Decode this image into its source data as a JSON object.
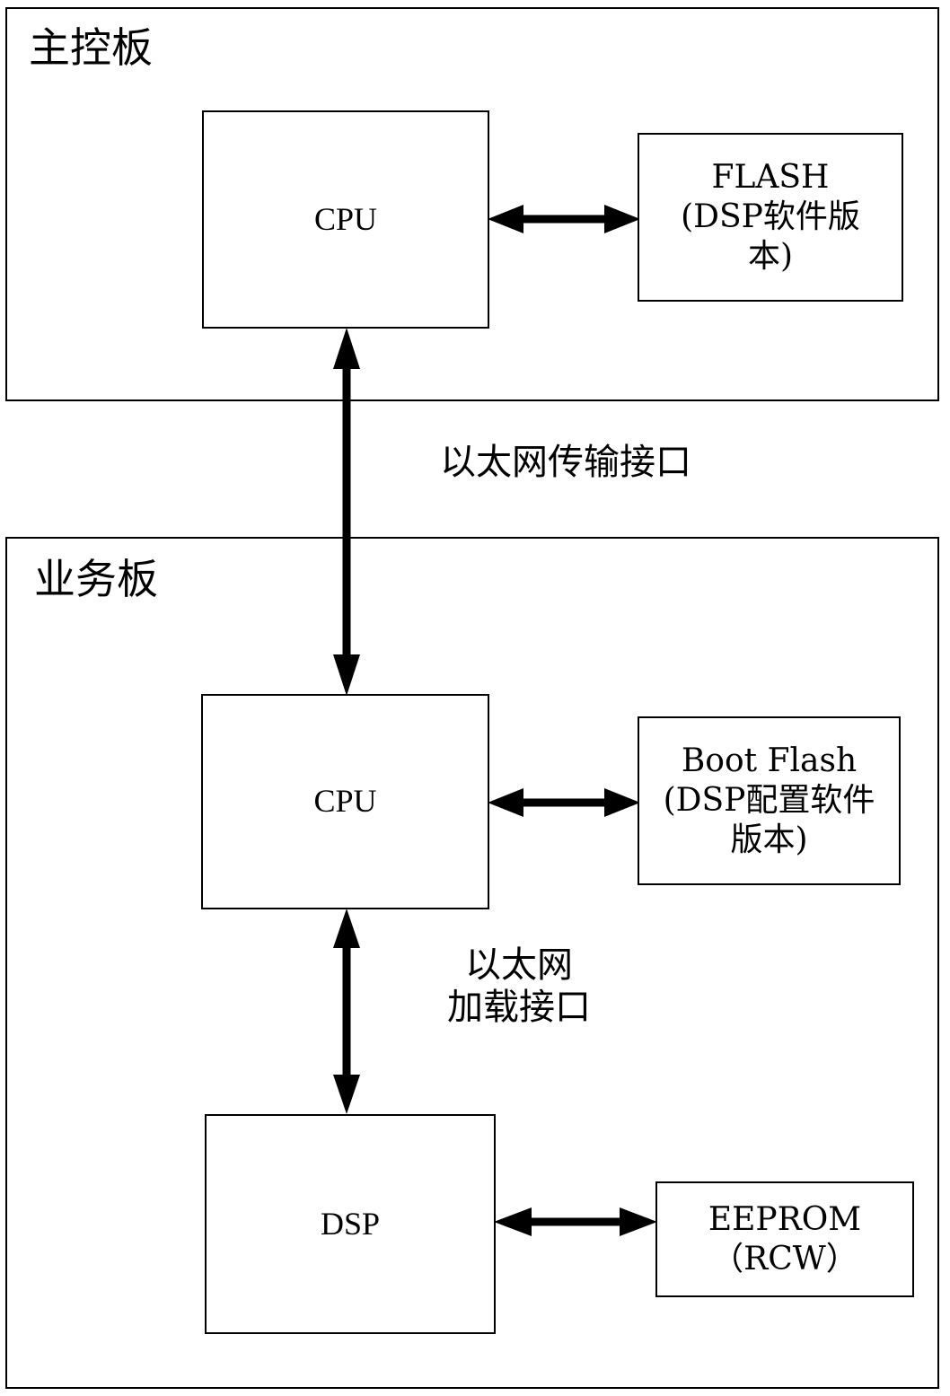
{
  "diagram": {
    "title": "",
    "panels": [
      {
        "id": "main-control-board",
        "label": "主控板"
      },
      {
        "id": "service-board",
        "label": "业务板"
      }
    ],
    "nodes": [
      {
        "id": "cpu-main",
        "label": "CPU"
      },
      {
        "id": "flash-main",
        "label": "FLASH\n(DSP软件版\n本)"
      },
      {
        "id": "cpu-service",
        "label": "CPU"
      },
      {
        "id": "boot-flash",
        "label": "Boot Flash\n(DSP配置软件\n版本)"
      },
      {
        "id": "dsp",
        "label": "DSP"
      },
      {
        "id": "eeprom",
        "label": "EEPROM\n（RCW）"
      }
    ],
    "edges": [
      {
        "id": "cpu-main-to-flash",
        "from": "cpu-main",
        "to": "flash-main",
        "direction": "bidirectional",
        "orientation": "horizontal",
        "label": ""
      },
      {
        "id": "cpu-main-to-cpu-service",
        "from": "cpu-main",
        "to": "cpu-service",
        "direction": "bidirectional",
        "orientation": "vertical",
        "label": "以太网传输接口"
      },
      {
        "id": "cpu-service-to-boot-flash",
        "from": "cpu-service",
        "to": "boot-flash",
        "direction": "bidirectional",
        "orientation": "horizontal",
        "label": ""
      },
      {
        "id": "cpu-service-to-dsp",
        "from": "cpu-service",
        "to": "dsp",
        "direction": "bidirectional",
        "orientation": "vertical",
        "label": "以太网\n加载接口"
      },
      {
        "id": "dsp-to-eeprom",
        "from": "dsp",
        "to": "eeprom",
        "direction": "bidirectional",
        "orientation": "horizontal",
        "label": ""
      }
    ],
    "colors": {
      "stroke": "#000000",
      "background": "#ffffff",
      "text": "#000000"
    }
  }
}
